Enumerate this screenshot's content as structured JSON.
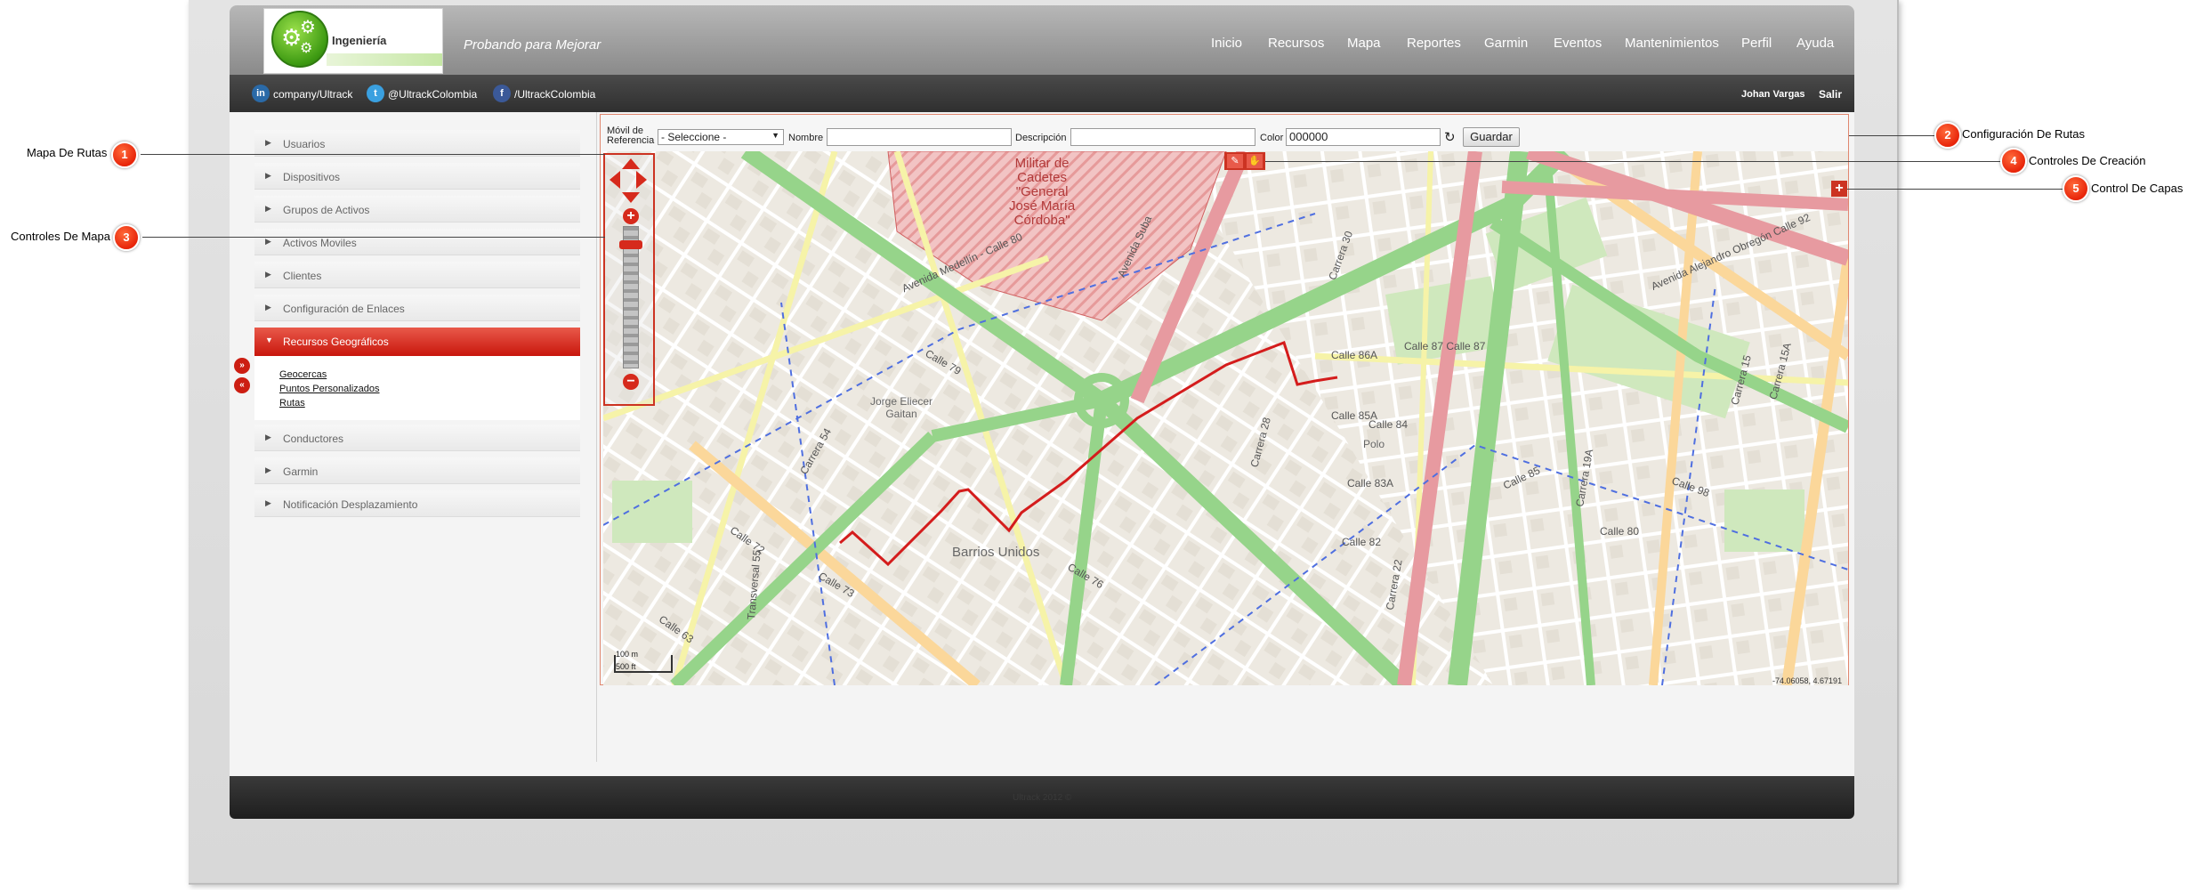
{
  "app": {
    "logo_text": "Ingeniería",
    "slogan": "Probando para Mejorar",
    "nav": [
      "Inicio",
      "Recursos",
      "Mapa",
      "Reportes",
      "Garmin",
      "Eventos",
      "Mantenimientos",
      "Perfil",
      "Ayuda"
    ],
    "social": [
      {
        "icon": "linkedin-icon",
        "label": "company/Ultrack",
        "glyph": "in",
        "color": "#2a6aa8"
      },
      {
        "icon": "twitter-icon",
        "label": "@UltrackColombia",
        "glyph": "t",
        "color": "#3aa0e0"
      },
      {
        "icon": "facebook-icon",
        "label": "/UltrackColombia",
        "glyph": "f",
        "color": "#3b5998"
      }
    ],
    "user_name": "Johan Vargas",
    "logout_label": "Salir",
    "footer_text": "Ultrack 2012 ©"
  },
  "sidebar": {
    "items": [
      "Usuarios",
      "Dispositivos",
      "Grupos de Activos",
      "Activos Moviles",
      "Clientes",
      "Configuración de Enlaces",
      "Recursos Geográficos",
      "Conductores",
      "Garmin",
      "Notificación Desplazamiento"
    ],
    "active_index": 6,
    "submenu": [
      "Geocercas",
      "Puntos Personalizados",
      "Rutas"
    ],
    "collapse_glyphs": [
      "»",
      "«"
    ]
  },
  "route_config": {
    "reference_label_line1": "Móvil de",
    "reference_label_line2": "Referencia",
    "reference_select_value": "- Seleccione -",
    "name_label": "Nombre",
    "name_value": "",
    "description_label": "Descripción",
    "description_value": "",
    "color_label": "Color",
    "color_value": "000000",
    "refresh_glyph": "↻",
    "save_label": "Guardar"
  },
  "map": {
    "places": {
      "military_school": [
        "Militar de",
        "Cadetes",
        "\"General",
        "José María",
        "Córdoba\""
      ],
      "jorge_eliecer": [
        "Jorge Eliecer",
        "Gaitan"
      ],
      "barrios_unidos": "Barrios Unidos",
      "polo": "Polo"
    },
    "street_labels": [
      {
        "text": "Avenida Medellín - Calle 80",
        "rot": -24
      },
      {
        "text": "Avenida Alejandro Obregón Calle 92",
        "rot": 24
      },
      {
        "text": "Avenida Suba",
        "rot": -65
      },
      {
        "text": "Transversal 55",
        "rot": -85
      },
      {
        "text": "Carrera 30",
        "rot": -70
      },
      {
        "text": "Calle 72",
        "rot": 35
      },
      {
        "text": "Calle 63",
        "rot": 35
      },
      {
        "text": "Calle 86A",
        "rot": 0
      },
      {
        "text": "Calle 87 Calle 87",
        "rot": 0
      },
      {
        "text": "Calle 85A",
        "rot": 0
      },
      {
        "text": "Calle 84",
        "rot": 0
      },
      {
        "text": "Calle 83A",
        "rot": 0
      },
      {
        "text": "Calle 82",
        "rot": 0
      },
      {
        "text": "Calle 80",
        "rot": 0
      },
      {
        "text": "Carrera 22",
        "rot": -80
      },
      {
        "text": "Carrera 19A",
        "rot": -80
      },
      {
        "text": "Calle 85",
        "rot": -25
      },
      {
        "text": "Calle 98",
        "rot": 20
      },
      {
        "text": "Carrera 15",
        "rot": -75
      },
      {
        "text": "Carrera 15A",
        "rot": -75
      },
      {
        "text": "Calle 76",
        "rot": 30
      },
      {
        "text": "Carrera 28",
        "rot": -75
      },
      {
        "text": "Calle 79",
        "rot": 30
      },
      {
        "text": "Carrera 54",
        "rot": -60
      },
      {
        "text": "Calle 73",
        "rot": 30
      }
    ],
    "coords": "-74.06058, 4.67191",
    "scale_top": "100 m",
    "scale_bottom": "500 ft",
    "create_glyphs": [
      "✎",
      "✋"
    ],
    "layers_glyph": "+",
    "zoom_plus": "+",
    "zoom_minus": "−"
  },
  "callouts": [
    {
      "number": "1",
      "label": "Mapa De Rutas"
    },
    {
      "number": "2",
      "label": "Configuración De Rutas"
    },
    {
      "number": "3",
      "label": "Controles De Mapa"
    },
    {
      "number": "4",
      "label": "Controles De Creación"
    },
    {
      "number": "5",
      "label": "Control De Capas"
    }
  ]
}
